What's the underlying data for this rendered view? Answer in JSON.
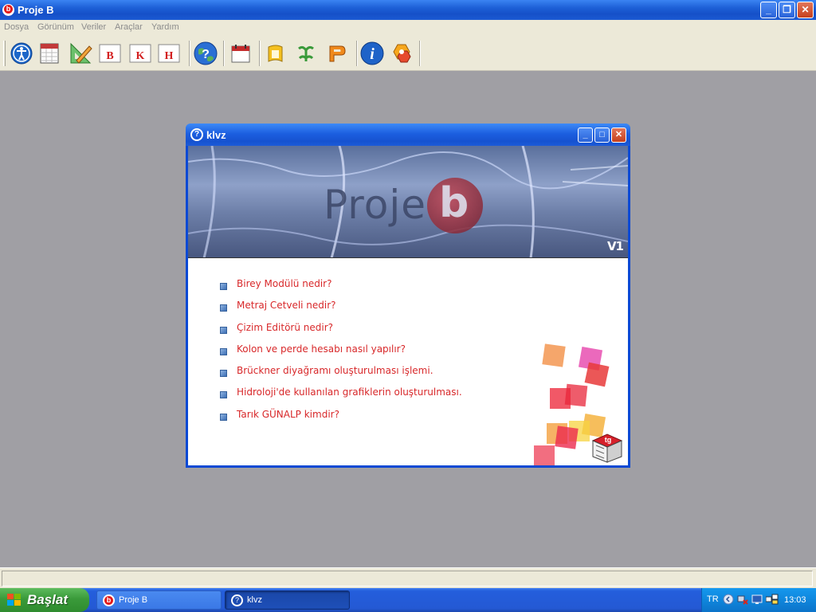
{
  "app": {
    "title": "Proje B"
  },
  "menu": [
    "Dosya",
    "Görünüm",
    "Veriler",
    "Araçlar",
    "Yardım"
  ],
  "toolbar": {
    "buttons": [
      {
        "name": "accessibility-icon"
      },
      {
        "name": "spreadsheet-icon"
      },
      {
        "name": "ruler-pencil-icon"
      },
      {
        "name": "b-module-icon",
        "letter": "B"
      },
      {
        "name": "k-module-icon",
        "letter": "K"
      },
      {
        "name": "h-module-icon",
        "letter": "H"
      },
      {
        "name": "help-globe-icon"
      },
      {
        "name": "calendar-icon"
      },
      {
        "name": "yellow-module-icon"
      },
      {
        "name": "green-module-icon"
      },
      {
        "name": "orange-module-icon"
      },
      {
        "name": "info-icon"
      },
      {
        "name": "hexagon-logo-icon"
      }
    ]
  },
  "dialog": {
    "title": "klvz",
    "banner": {
      "logo_text": "Proje",
      "logo_letter": "b",
      "version": "V1"
    },
    "links": [
      "Birey Modülü nedir?",
      "Metraj Cetveli nedir?",
      "Çizim Editörü nedir?",
      "Kolon ve perde hesabı nasıl yapılır?",
      "Brückner diyağramı oluşturulması işlemi.",
      "Hidroloji'de kullanılan grafiklerin oluşturulması.",
      "Tarık GÜNALP kimdir?"
    ],
    "badge": "tg"
  },
  "taskbar": {
    "start_label": "Başlat",
    "tasks": [
      "Proje B",
      "klvz"
    ],
    "tray": {
      "lang": "TR",
      "clock": "13:03"
    }
  },
  "colors": {
    "link": "#d8282a",
    "titlebar": "#1d5fd6",
    "taskbar": "#245edc",
    "start": "#3a9a3a"
  }
}
